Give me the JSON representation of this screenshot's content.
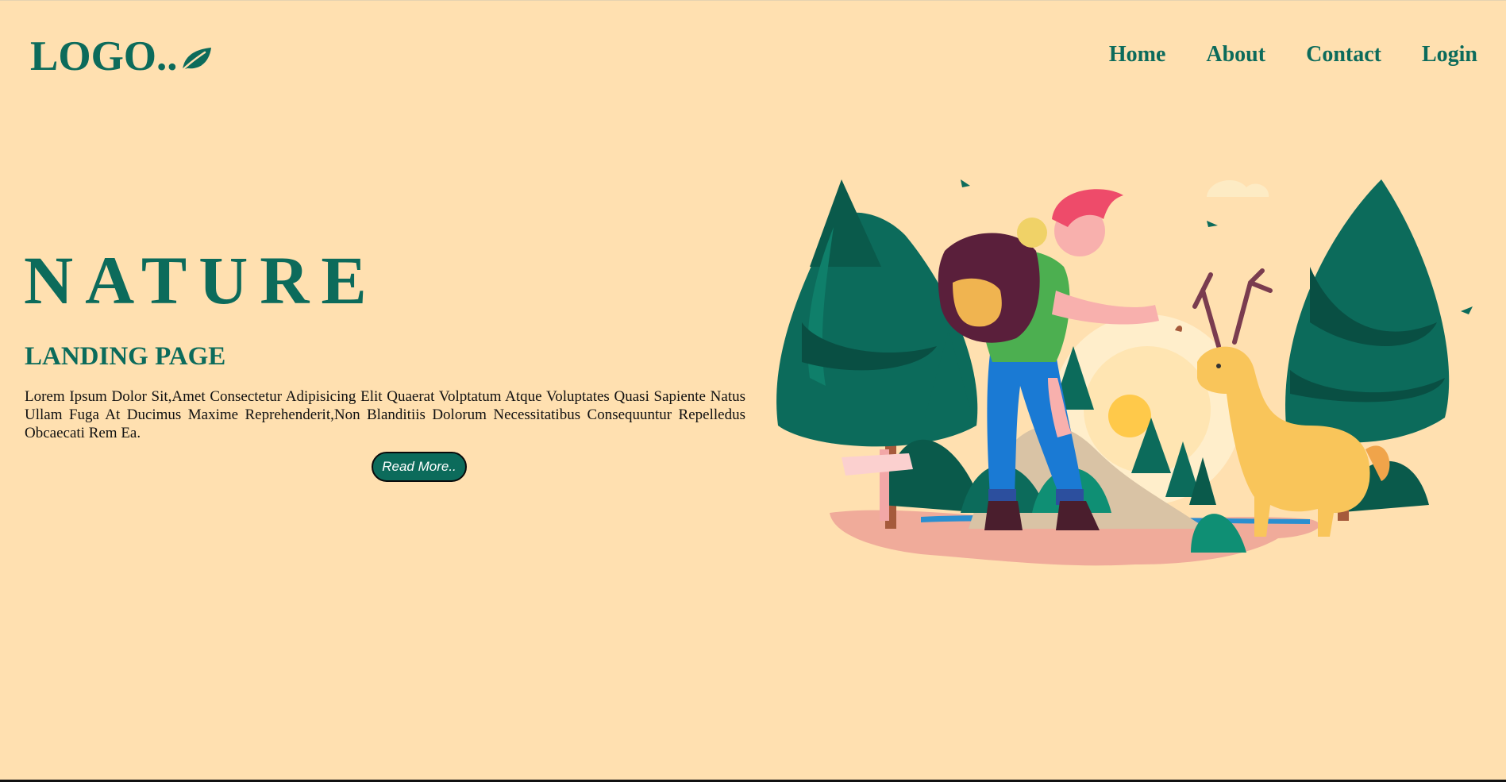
{
  "header": {
    "logo_text": "LOGO..",
    "nav": [
      {
        "label": "Home"
      },
      {
        "label": "About"
      },
      {
        "label": "Contact"
      },
      {
        "label": "Login"
      }
    ]
  },
  "hero": {
    "title": "NATURE",
    "subtitle": "LANDING PAGE",
    "body": "Lorem Ipsum Dolor Sit,Amet Consectetur Adipisicing Elit Quaerat Volptatum Atque Voluptates Quasi Sapiente Natus Ullam Fuga At Ducimus Maxime Reprehenderit,Non Blanditiis Dolorum Necessitatibus Consequuntur Repelledus Obcaecati Rem Ea.",
    "button_label": "Read More.."
  },
  "colors": {
    "background": "#ffe0b0",
    "accent": "#0c6b5b",
    "text": "#111111"
  },
  "icons": {
    "logo_leaf": "leaf-icon"
  }
}
